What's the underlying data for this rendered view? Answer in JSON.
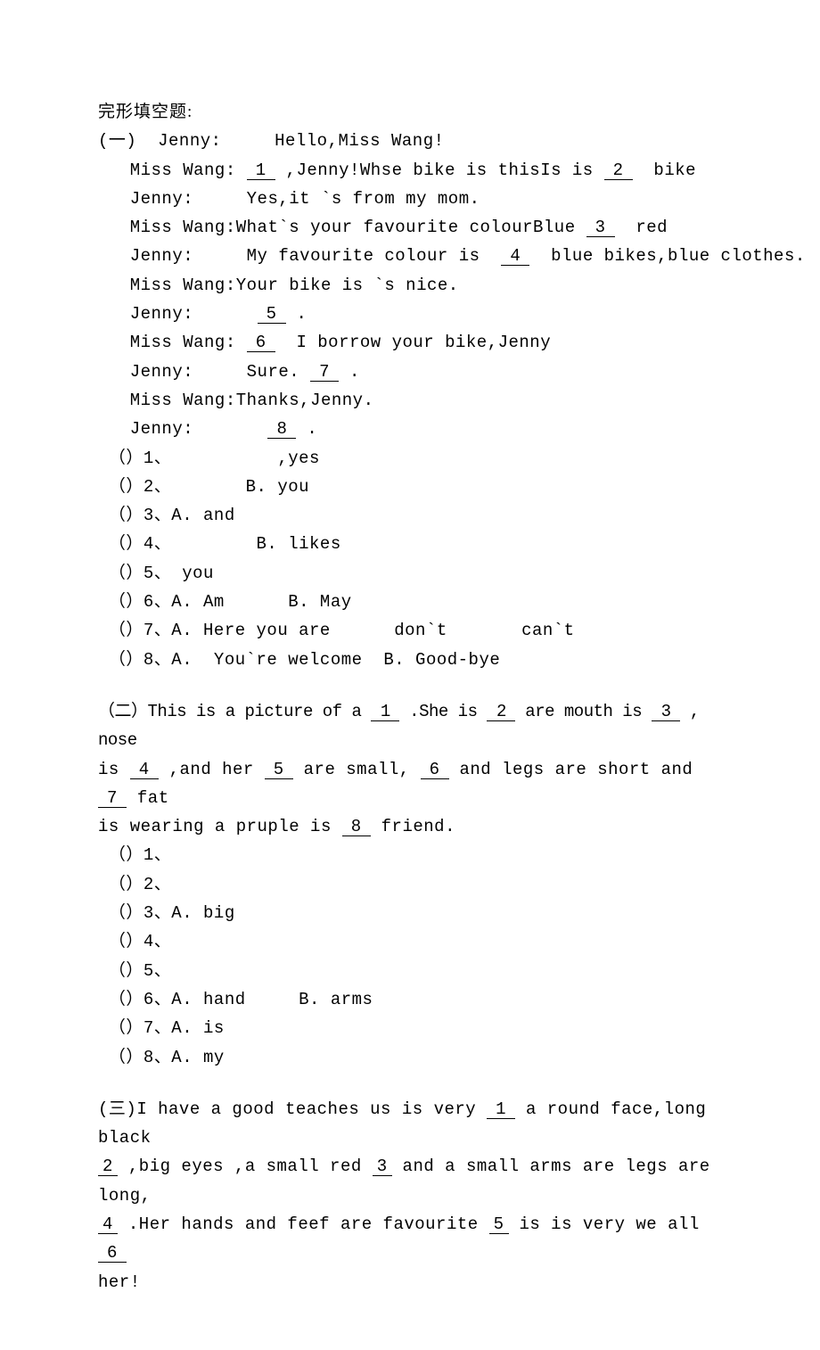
{
  "header": "完形填空题:",
  "ex1": {
    "label": "(一)",
    "dialog": {
      "l1_speaker": "Jenny:",
      "l1_text": "Hello,Miss Wang!",
      "l2_speaker": "Miss Wang:",
      "l2_pre": " ",
      "l2_blank": "1",
      "l2_post1": " ,Jenny!Whse bike is thisIs is ",
      "l2_blank2": "2",
      "l2_post2": "  bike",
      "l3_speaker": "Jenny:",
      "l3_text": "Yes,it `s from my mom.",
      "l4_speaker": "Miss Wang:",
      "l4_text_pre": "What`s your favourite colourBlue ",
      "l4_blank": "3",
      "l4_text_post": "  red",
      "l5_speaker": "Jenny:",
      "l5_text_pre": "My favourite colour is  ",
      "l5_blank": "4",
      "l5_text_post": "  blue bikes,blue clothes.",
      "l6_speaker": "Miss Wang:",
      "l6_text": "Your bike is `s nice.",
      "l7_speaker": "Jenny:",
      "l7_blank": "5",
      "l7_post": " .",
      "l8_speaker": "Miss Wang:",
      "l8_blank": "6",
      "l8_post": "  I borrow your bike,Jenny",
      "l9_speaker": "Jenny:",
      "l9_text": "Sure. ",
      "l9_blank": "7",
      "l9_post": " .",
      "l10_speaker": "Miss Wang:",
      "l10_text": "Thanks,Jenny.",
      "l11_speaker": "Jenny:",
      "l11_blank": "8",
      "l11_post": " ."
    },
    "q": {
      "q1": "（）1、          ,yes",
      "q2": "（）2、       B. you",
      "q3": "（）3、A. and",
      "q4": "（）4、        B. likes",
      "q5": "（）5、 you",
      "q6": "（）6、A. Am      B. May",
      "q7": "（）7、A. Here you are      don`t       can`t",
      "q8": "（）8、A.  You`re welcome  B. Good-bye"
    }
  },
  "ex2": {
    "label": "（二）",
    "p1": "This is a picture of a ",
    "b1": "1",
    "p2": " .She is ",
    "b2": "2",
    "p3": " are  mouth is ",
    "b3": "3",
    "p4": " , nose",
    "p5": "is  ",
    "b4": "4",
    "p6": " ,and her ",
    "b5": "5",
    "p7": " are small, ",
    "b6": "6",
    "p8": " and legs are short and ",
    "b7": "7",
    "p9": " fat",
    "p10": "is wearing a pruple  is ",
    "b8": "8",
    "p11": " friend.",
    "q": {
      "q1": "（）1、",
      "q2": "（）2、",
      "q3": "（）3、A. big",
      "q4": "（）4、",
      "q5": "（）5、",
      "q6": "（）6、A. hand     B. arms",
      "q7": "（）7、A. is",
      "q8": "（）8、A. my"
    }
  },
  "ex3": {
    "label": "(三)",
    "p1": "I have a good  teaches us  is very ",
    "b1": "1",
    "p2": " a round face,long black",
    "b2": "2",
    "p3": " ,big eyes ,a small red ",
    "b3": "3",
    "p4": " and a small  arms are  legs are long,",
    "b4": "4",
    "p5": " .Her hands and feef are  favourite ",
    "b5": "5",
    "p6": " is  is very  we all ",
    "b6": "6",
    "p7": "her!"
  }
}
